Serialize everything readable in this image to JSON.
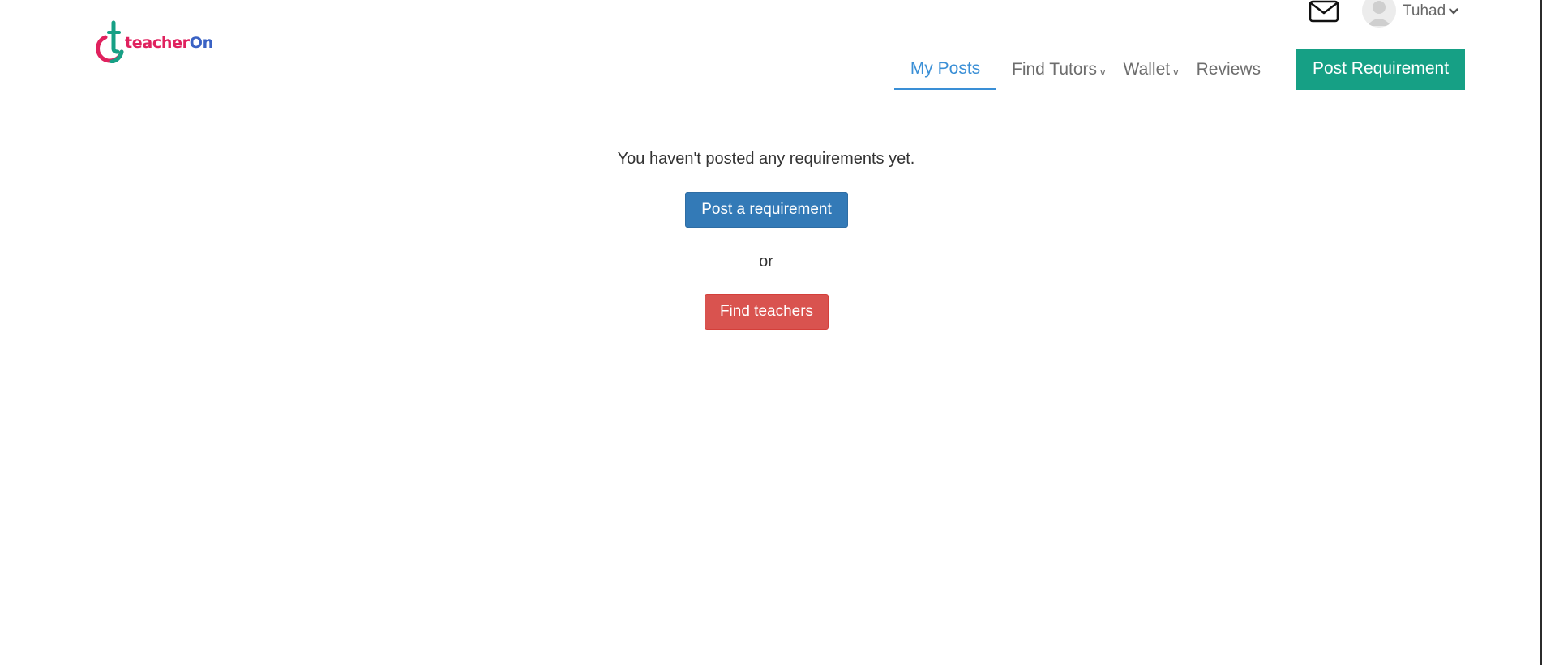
{
  "brand": {
    "logo_text_part1": "teacher",
    "logo_text_part2": "On",
    "colors": {
      "pink": "#e0215e",
      "teal": "#16a085",
      "blue": "#3a62c4"
    }
  },
  "header": {
    "mail_icon": "envelope-icon",
    "user": {
      "name": "Tuhad",
      "avatar_icon": "user-avatar-icon",
      "chevron_icon": "chevron-down-icon"
    }
  },
  "nav": {
    "items": [
      {
        "label": "My Posts",
        "active": true
      },
      {
        "label": "Find Tutors",
        "has_dropdown": true,
        "chevron": "v"
      },
      {
        "label": "Wallet",
        "has_dropdown": true,
        "chevron": "v"
      },
      {
        "label": "Reviews"
      }
    ],
    "cta_label": "Post Requirement"
  },
  "main": {
    "empty_message": "You haven't posted any requirements yet.",
    "post_button_label": "Post a requirement",
    "or_label": "or",
    "find_button_label": "Find teachers"
  },
  "colors": {
    "active_nav": "#3a8fd6",
    "primary_button": "#337ab7",
    "danger_button": "#d9534f",
    "cta_button": "#16a085"
  }
}
